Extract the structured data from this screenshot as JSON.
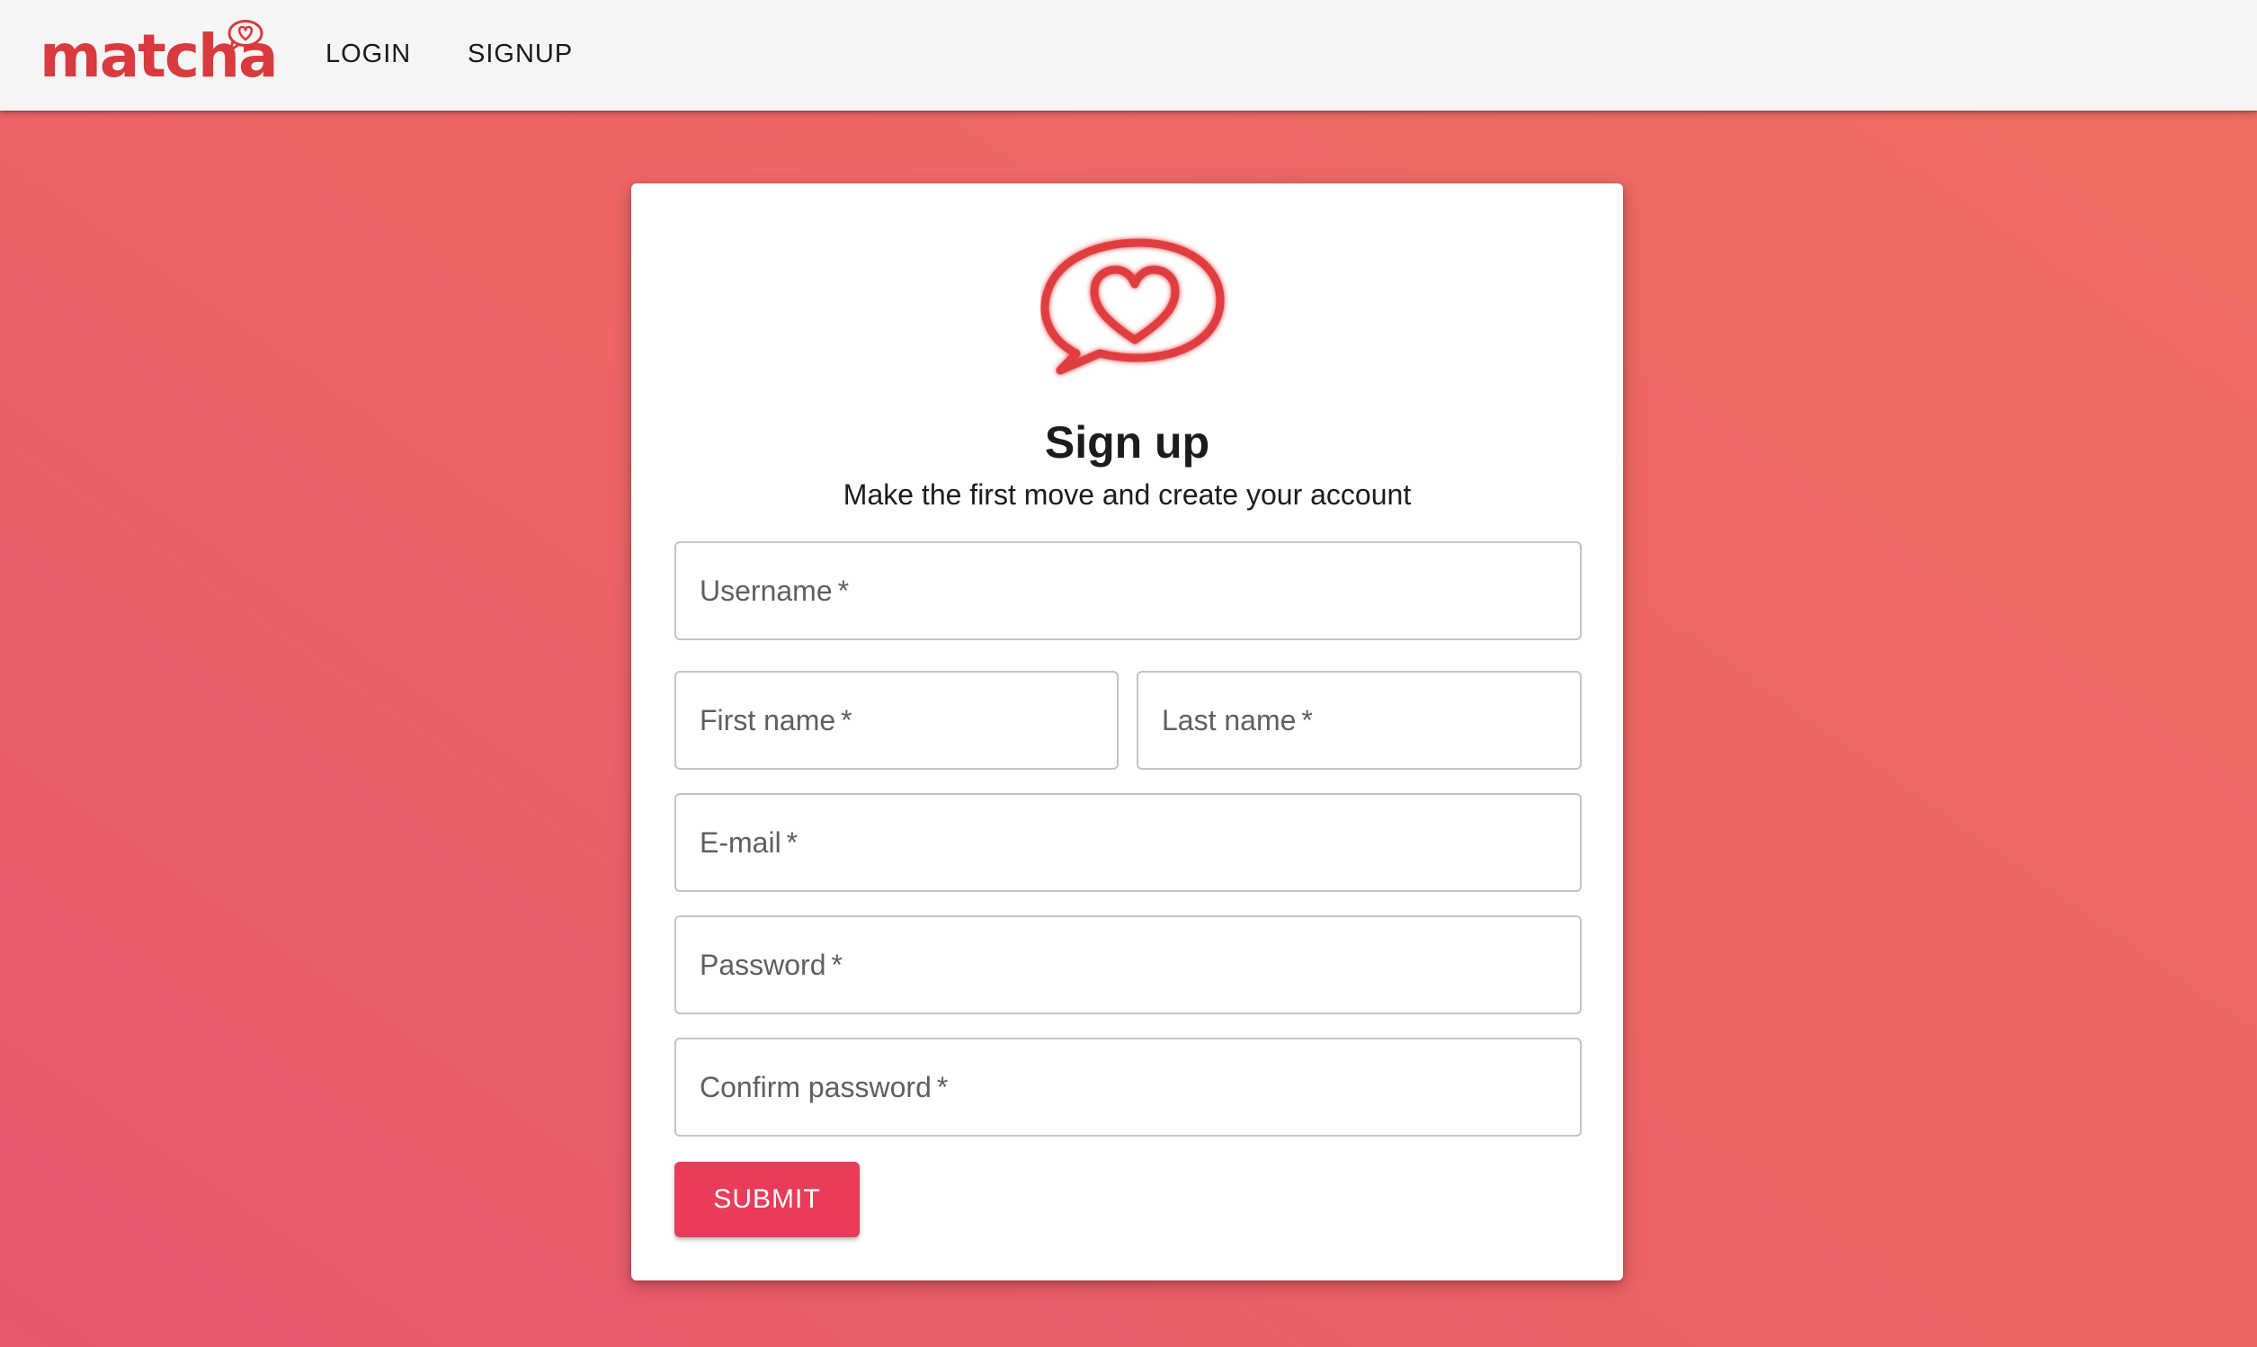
{
  "brand": {
    "name": "matcha",
    "color": "#d93a3e"
  },
  "nav": {
    "login_label": "LOGIN",
    "signup_label": "SIGNUP"
  },
  "card": {
    "icon": "heart-chat-bubble-icon",
    "title": "Sign up",
    "subtitle": "Make the first move and create your account"
  },
  "form": {
    "username_label": "Username",
    "first_name_label": "First name",
    "last_name_label": "Last name",
    "email_label": "E-mail",
    "password_label": "Password",
    "confirm_password_label": "Confirm password",
    "required_marker": "*",
    "submit_label": "SUBMIT"
  },
  "colors": {
    "accent": "#e83c5a",
    "background_start": "#e8566f",
    "background_end": "#ee6c61",
    "navbar": "#f5f5f5"
  }
}
